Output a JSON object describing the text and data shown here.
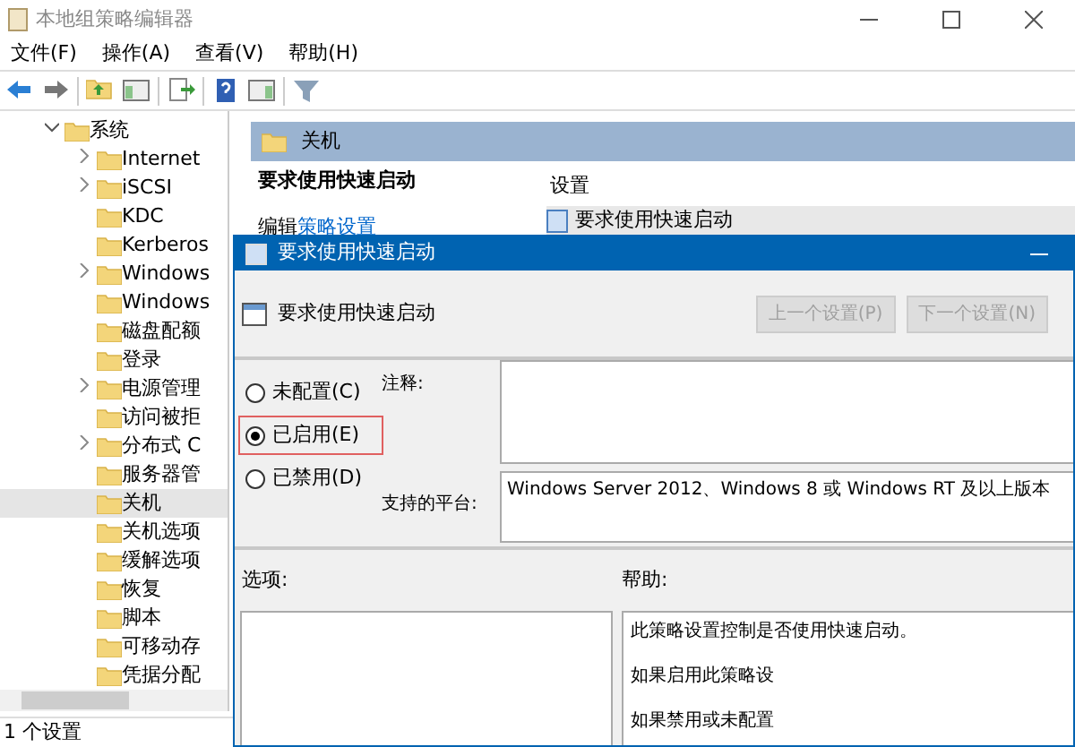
{
  "window": {
    "title": "本地组策略编辑器"
  },
  "menu": [
    "文件(F)",
    "操作(A)",
    "查看(V)",
    "帮助(H)"
  ],
  "tree": {
    "items": [
      {
        "label": "系统",
        "expanded": true,
        "selected": false,
        "children": [
          {
            "label": "Internet",
            "expandable": true,
            "selected": false
          },
          {
            "label": "iSCSI",
            "expandable": true,
            "selected": false
          },
          {
            "label": "KDC",
            "expandable": false,
            "selected": false
          },
          {
            "label": "Kerberos",
            "expandable": false,
            "selected": false
          },
          {
            "label": "Windows",
            "expandable": true,
            "selected": false
          },
          {
            "label": "Windows",
            "expandable": false,
            "selected": false
          },
          {
            "label": "磁盘配额",
            "expandable": false,
            "selected": false
          },
          {
            "label": "登录",
            "expandable": false,
            "selected": false
          },
          {
            "label": "电源管理",
            "expandable": true,
            "selected": false
          },
          {
            "label": "访问被拒",
            "expandable": false,
            "selected": false
          },
          {
            "label": "分布式 C",
            "expandable": true,
            "selected": false
          },
          {
            "label": "服务器管",
            "expandable": false,
            "selected": false
          },
          {
            "label": "关机",
            "expandable": false,
            "selected": true
          },
          {
            "label": "关机选项",
            "expandable": false,
            "selected": false
          },
          {
            "label": "缓解选项",
            "expandable": false,
            "selected": false
          },
          {
            "label": "恢复",
            "expandable": false,
            "selected": false
          },
          {
            "label": "脚本",
            "expandable": false,
            "selected": false
          },
          {
            "label": "可移动存",
            "expandable": false,
            "selected": false
          },
          {
            "label": "凭据分配",
            "expandable": false,
            "selected": false
          }
        ]
      }
    ]
  },
  "details": {
    "header": "关机",
    "policy_title": "要求使用快速启动",
    "edit_prefix": "编辑",
    "edit_link": "策略设置",
    "column": "设置",
    "rows": [
      {
        "label": "要求使用快速启动",
        "selected": true
      }
    ]
  },
  "status_bar": "1 个设置",
  "dialog": {
    "title": "要求使用快速启动",
    "heading": "要求使用快速启动",
    "buttons": [
      {
        "label": "上一个设置(P)",
        "disabled": true
      },
      {
        "label": "下一个设置(N)",
        "disabled": true
      }
    ],
    "options": [
      {
        "label": "未配置(C)",
        "selected": false,
        "highlighted": false
      },
      {
        "label": "已启用(E)",
        "selected": true,
        "highlighted": true
      },
      {
        "label": "已禁用(D)",
        "selected": false,
        "highlighted": false
      }
    ],
    "comment_label": "注释:",
    "platform_label": "支持的平台:",
    "platform": "Windows Server 2012、Windows 8 或 Windows RT 及以上版本",
    "options_label": "选项:",
    "help_label": "帮助:",
    "help": [
      "此策略设置控制是否使用快速启动。",
      "如果启用此策略设",
      "如果禁用或未配置"
    ]
  }
}
